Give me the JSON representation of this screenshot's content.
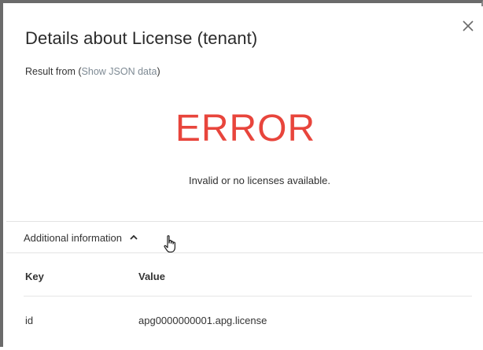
{
  "dialog": {
    "title": "Details about License (tenant)",
    "result_prefix": "Result from (",
    "result_link": "Show JSON data",
    "result_suffix": ")",
    "close_icon": "close-icon"
  },
  "status": {
    "heading": "ERROR",
    "message": "Invalid or no licenses available.",
    "color": "#e8453c"
  },
  "additional": {
    "label": "Additional information",
    "expanded": true,
    "icon": "chevron-up-icon"
  },
  "table": {
    "headers": [
      "Key",
      "Value"
    ],
    "rows": [
      [
        "id",
        "apg0000000001.apg.license"
      ]
    ]
  }
}
